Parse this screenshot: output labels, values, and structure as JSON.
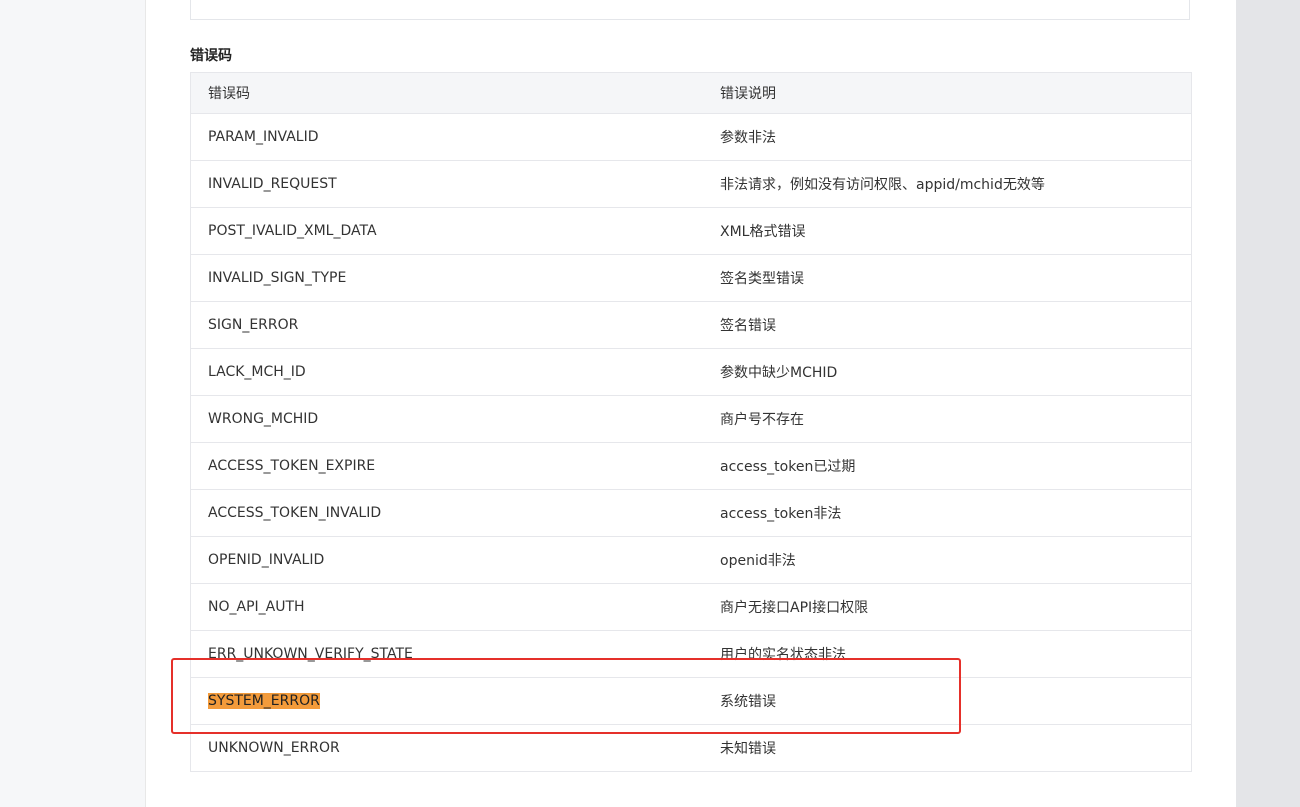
{
  "section": {
    "title": "错误码"
  },
  "table": {
    "headers": [
      "错误码",
      "错误说明"
    ],
    "rows": [
      {
        "code": "PARAM_INVALID",
        "desc": "参数非法"
      },
      {
        "code": "INVALID_REQUEST",
        "desc": "非法请求，例如没有访问权限、appid/mchid无效等"
      },
      {
        "code": "POST_IVALID_XML_DATA",
        "desc": "XML格式错误"
      },
      {
        "code": "INVALID_SIGN_TYPE",
        "desc": "签名类型错误"
      },
      {
        "code": "SIGN_ERROR",
        "desc": "签名错误"
      },
      {
        "code": "LACK_MCH_ID",
        "desc": "参数中缺少MCHID"
      },
      {
        "code": "WRONG_MCHID",
        "desc": "商户号不存在"
      },
      {
        "code": "ACCESS_TOKEN_EXPIRE",
        "desc": "access_token已过期"
      },
      {
        "code": "ACCESS_TOKEN_INVALID",
        "desc": "access_token非法"
      },
      {
        "code": "OPENID_INVALID",
        "desc": "openid非法"
      },
      {
        "code": "NO_API_AUTH",
        "desc": "商户无接口API接口权限"
      },
      {
        "code": "ERR_UNKOWN_VERIFY_STATE",
        "desc": "用户的实名状态非法"
      },
      {
        "code": "SYSTEM_ERROR",
        "desc": "系统错误"
      },
      {
        "code": "UNKNOWN_ERROR",
        "desc": "未知错误"
      }
    ]
  },
  "highlight": {
    "row_code": "SYSTEM_ERROR",
    "color": "#f39b3b"
  },
  "annotation": {
    "color": "#e5302a"
  }
}
